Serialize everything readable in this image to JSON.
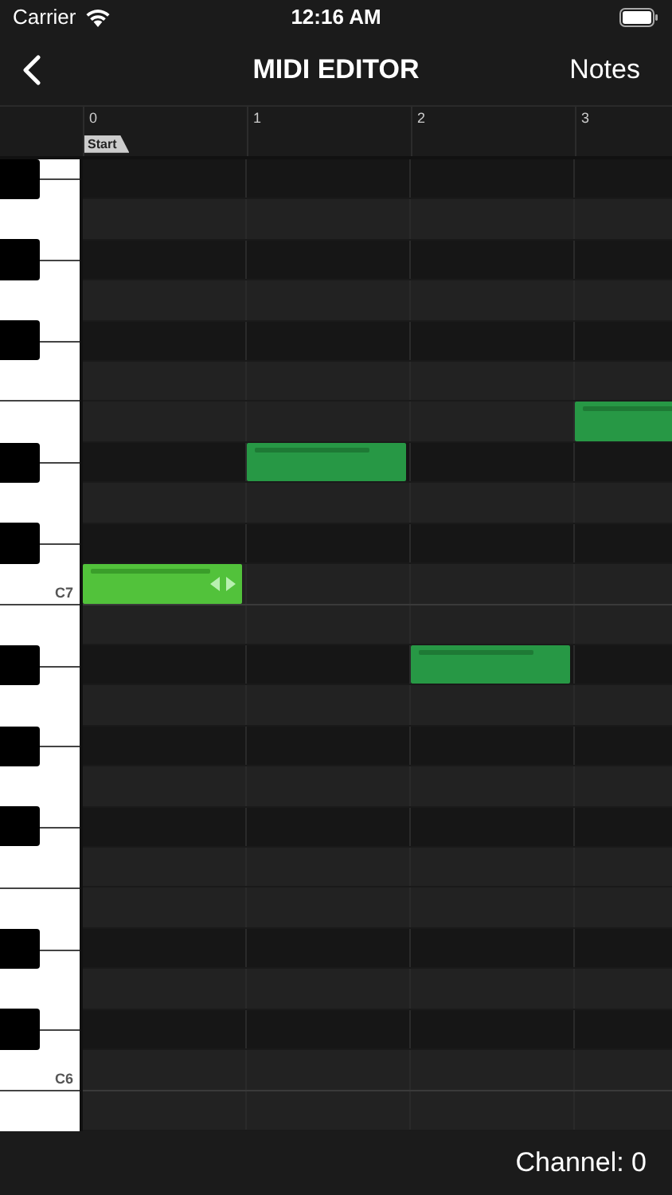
{
  "status_bar": {
    "carrier": "Carrier",
    "time": "12:16 AM"
  },
  "nav": {
    "title": "MIDI EDITOR",
    "right": "Notes"
  },
  "ruler": {
    "beats": [
      "0",
      "1",
      "2",
      "3"
    ],
    "start_tag": "Start"
  },
  "rows": [
    {
      "kind": "black",
      "cells": [
        {
          "kind": "empty"
        },
        {
          "kind": "empty"
        },
        {
          "kind": "empty"
        },
        {
          "kind": "empty"
        }
      ]
    },
    {
      "kind": "white",
      "cells": [
        {
          "kind": "empty"
        },
        {
          "kind": "empty"
        },
        {
          "kind": "empty"
        },
        {
          "kind": "empty"
        }
      ]
    },
    {
      "kind": "black",
      "cells": [
        {
          "kind": "empty"
        },
        {
          "kind": "empty"
        },
        {
          "kind": "empty"
        },
        {
          "kind": "empty"
        }
      ]
    },
    {
      "kind": "white",
      "cells": [
        {
          "kind": "empty"
        },
        {
          "kind": "empty"
        },
        {
          "kind": "empty"
        },
        {
          "kind": "empty"
        }
      ]
    },
    {
      "kind": "black",
      "cells": [
        {
          "kind": "empty"
        },
        {
          "kind": "empty"
        },
        {
          "kind": "empty"
        },
        {
          "kind": "empty"
        }
      ]
    },
    {
      "kind": "white",
      "cells": [
        {
          "kind": "empty"
        },
        {
          "kind": "empty"
        },
        {
          "kind": "empty"
        },
        {
          "kind": "empty"
        }
      ]
    },
    {
      "kind": "white",
      "cells": [
        {
          "kind": "empty"
        },
        {
          "kind": "empty"
        },
        {
          "kind": "empty"
        },
        {
          "kind": "note",
          "selected": false,
          "level": 0.72
        }
      ]
    },
    {
      "kind": "black",
      "cells": [
        {
          "kind": "empty"
        },
        {
          "kind": "note",
          "selected": false,
          "level": 0.72
        },
        {
          "kind": "empty"
        },
        {
          "kind": "empty"
        }
      ]
    },
    {
      "kind": "white",
      "cells": [
        {
          "kind": "empty"
        },
        {
          "kind": "empty"
        },
        {
          "kind": "empty"
        },
        {
          "kind": "empty"
        }
      ]
    },
    {
      "kind": "black",
      "cells": [
        {
          "kind": "empty"
        },
        {
          "kind": "empty"
        },
        {
          "kind": "empty"
        },
        {
          "kind": "empty"
        }
      ]
    },
    {
      "kind": "white",
      "label": "C7",
      "cells": [
        {
          "kind": "note",
          "selected": true,
          "level": 0.75
        },
        {
          "kind": "empty"
        },
        {
          "kind": "empty"
        },
        {
          "kind": "empty"
        }
      ]
    },
    {
      "kind": "white",
      "cells": [
        {
          "kind": "empty"
        },
        {
          "kind": "empty"
        },
        {
          "kind": "empty"
        },
        {
          "kind": "empty"
        }
      ]
    },
    {
      "kind": "black",
      "cells": [
        {
          "kind": "empty"
        },
        {
          "kind": "empty"
        },
        {
          "kind": "note",
          "selected": false,
          "level": 0.72
        },
        {
          "kind": "empty"
        }
      ]
    },
    {
      "kind": "white",
      "cells": [
        {
          "kind": "empty"
        },
        {
          "kind": "empty"
        },
        {
          "kind": "empty"
        },
        {
          "kind": "empty"
        }
      ]
    },
    {
      "kind": "black",
      "cells": [
        {
          "kind": "empty"
        },
        {
          "kind": "empty"
        },
        {
          "kind": "empty"
        },
        {
          "kind": "empty"
        }
      ]
    },
    {
      "kind": "white",
      "cells": [
        {
          "kind": "empty"
        },
        {
          "kind": "empty"
        },
        {
          "kind": "empty"
        },
        {
          "kind": "empty"
        }
      ]
    },
    {
      "kind": "black",
      "cells": [
        {
          "kind": "empty"
        },
        {
          "kind": "empty"
        },
        {
          "kind": "empty"
        },
        {
          "kind": "empty"
        }
      ]
    },
    {
      "kind": "white",
      "cells": [
        {
          "kind": "empty"
        },
        {
          "kind": "empty"
        },
        {
          "kind": "empty"
        },
        {
          "kind": "empty"
        }
      ]
    },
    {
      "kind": "white",
      "cells": [
        {
          "kind": "empty"
        },
        {
          "kind": "empty"
        },
        {
          "kind": "empty"
        },
        {
          "kind": "empty"
        }
      ]
    },
    {
      "kind": "black",
      "cells": [
        {
          "kind": "empty"
        },
        {
          "kind": "empty"
        },
        {
          "kind": "empty"
        },
        {
          "kind": "empty"
        }
      ]
    },
    {
      "kind": "white",
      "cells": [
        {
          "kind": "empty"
        },
        {
          "kind": "empty"
        },
        {
          "kind": "empty"
        },
        {
          "kind": "empty"
        }
      ]
    },
    {
      "kind": "black",
      "cells": [
        {
          "kind": "empty"
        },
        {
          "kind": "empty"
        },
        {
          "kind": "empty"
        },
        {
          "kind": "empty"
        }
      ]
    },
    {
      "kind": "white",
      "label": "C6",
      "cells": [
        {
          "kind": "empty"
        },
        {
          "kind": "empty"
        },
        {
          "kind": "empty"
        },
        {
          "kind": "empty"
        }
      ]
    },
    {
      "kind": "white",
      "cells": [
        {
          "kind": "empty"
        },
        {
          "kind": "empty"
        },
        {
          "kind": "empty"
        },
        {
          "kind": "empty"
        }
      ]
    }
  ],
  "footer": {
    "channel": "Channel: 0"
  }
}
